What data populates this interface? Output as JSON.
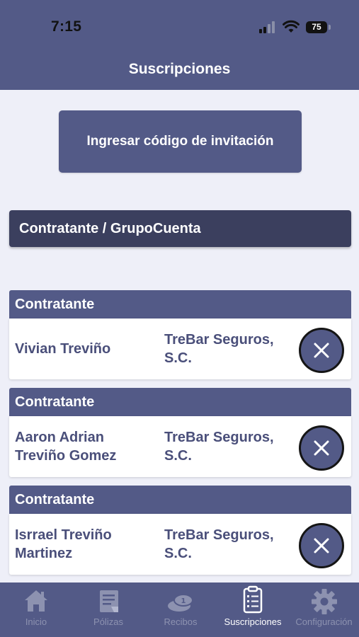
{
  "status_bar": {
    "time": "7:15",
    "battery": "75"
  },
  "nav": {
    "title": "Suscripciones"
  },
  "invite_button": {
    "label": "Ingresar código de invitación"
  },
  "group_header": {
    "label": "Contratante / GrupoCuenta"
  },
  "subscriptions": [
    {
      "header": "Contratante",
      "name_line1": "Vivian Treviño",
      "name_line2": "",
      "company_line1": "TreBar Seguros,",
      "company_line2": "S.C."
    },
    {
      "header": "Contratante",
      "name_line1": "Aaron Adrian",
      "name_line2": "Treviño Gomez",
      "company_line1": "TreBar Seguros,",
      "company_line2": "S.C."
    },
    {
      "header": "Contratante",
      "name_line1": "Isrrael Treviño",
      "name_line2": "Martinez",
      "company_line1": "TreBar Seguros,",
      "company_line2": "S.C."
    }
  ],
  "tabbar": {
    "items": [
      {
        "label": "Inicio",
        "icon": "home-icon"
      },
      {
        "label": "Pólizas",
        "icon": "policy-document-icon"
      },
      {
        "label": "Recibos",
        "icon": "coins-icon"
      },
      {
        "label": "Suscripciones",
        "icon": "clipboard-list-icon"
      },
      {
        "label": "Configuración",
        "icon": "gear-icon"
      }
    ],
    "active": "Suscripciones"
  },
  "colors": {
    "primary": "#535a87",
    "dark_header": "#3b3f5e",
    "background": "#eeeff8",
    "text": "#4a4f7a",
    "inactive_tab": "#8d92b0"
  }
}
